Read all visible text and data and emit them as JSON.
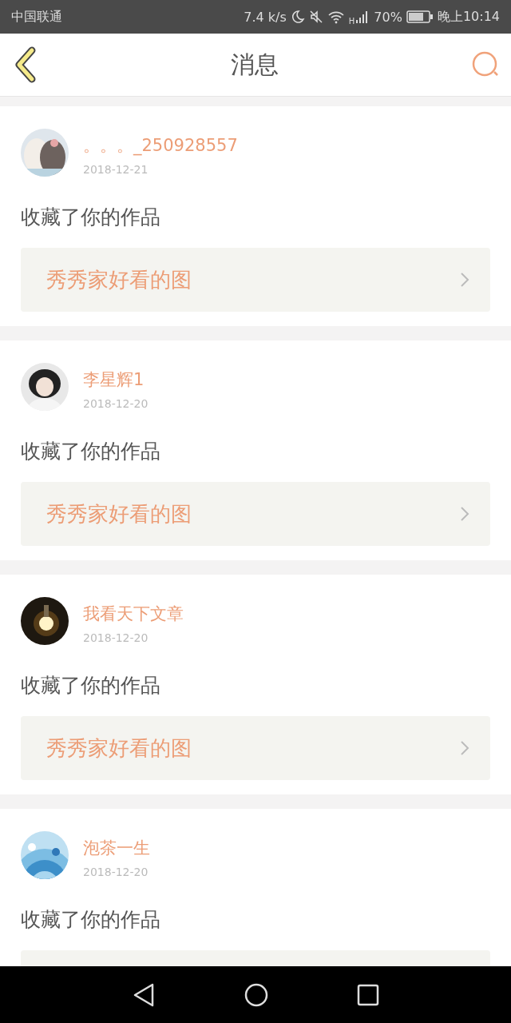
{
  "status_bar": {
    "carrier": "中国联通",
    "speed": "7.4 k/s",
    "network": "H",
    "battery": "70%",
    "time": "晚上10:14"
  },
  "header": {
    "title": "消息"
  },
  "messages": [
    {
      "name": "。。。_250928557",
      "date": "2018-12-21",
      "action": "收藏了你的作品",
      "link": "秀秀家好看的图"
    },
    {
      "name": "李星辉1",
      "date": "2018-12-20",
      "action": "收藏了你的作品",
      "link": "秀秀家好看的图"
    },
    {
      "name": "我看天下文章",
      "date": "2018-12-20",
      "action": "收藏了你的作品",
      "link": "秀秀家好看的图"
    },
    {
      "name": "泡茶一生",
      "date": "2018-12-20",
      "action": "收藏了你的作品"
    }
  ]
}
